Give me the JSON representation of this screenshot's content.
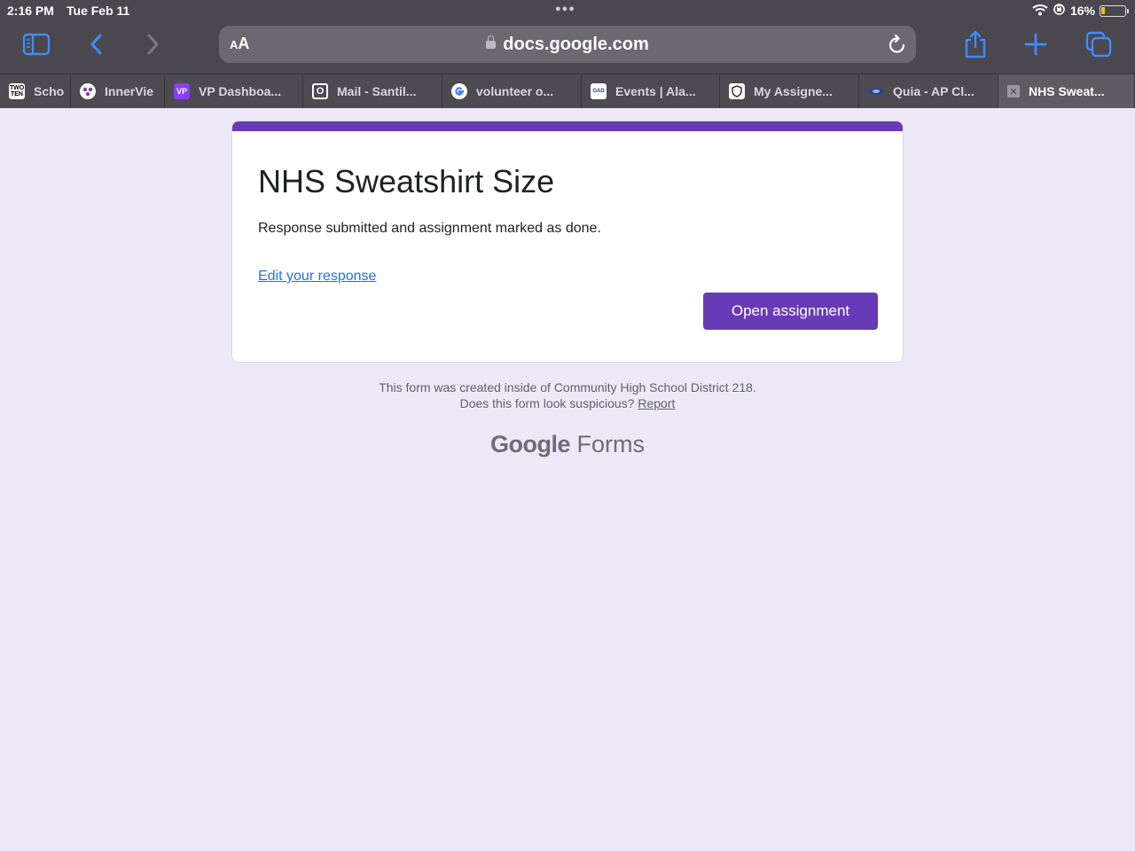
{
  "status_bar": {
    "time": "2:16 PM",
    "date": "Tue Feb 11",
    "battery": "16%",
    "battery_level": 0.16
  },
  "toolbar": {
    "text_size_label": "AA",
    "url": "docs.google.com",
    "icons": [
      "sidebar-icon",
      "back-icon",
      "forward-icon",
      "lock-icon",
      "reload-icon",
      "share-icon",
      "plus-icon",
      "tabs-icon"
    ]
  },
  "tabs": [
    {
      "label": "Schol",
      "favicon": "TWO TEN"
    },
    {
      "label": "InnerVie",
      "favicon": ""
    },
    {
      "label": "VP Dashboa...",
      "favicon": "VP"
    },
    {
      "label": "Mail - Santil...",
      "favicon": "O"
    },
    {
      "label": "volunteer o...",
      "favicon": "G"
    },
    {
      "label": "Events | Ala...",
      "favicon": "GAD"
    },
    {
      "label": "My Assigne...",
      "favicon": ""
    },
    {
      "label": "Quia - AP Cl...",
      "favicon": ""
    },
    {
      "label": "NHS Sweat...",
      "favicon": ""
    }
  ],
  "form": {
    "title": "NHS Sweatshirt Size",
    "message": "Response submitted and assignment marked as done.",
    "edit_link": "Edit your response",
    "button_label": "Open assignment",
    "accent_color": "#673ab7"
  },
  "footer": {
    "line1": "This form was created inside of Community High School District 218.",
    "line2": "Does this form look suspicious?",
    "report_link": "Report",
    "brand_google": "Google",
    "brand_forms": "Forms"
  }
}
